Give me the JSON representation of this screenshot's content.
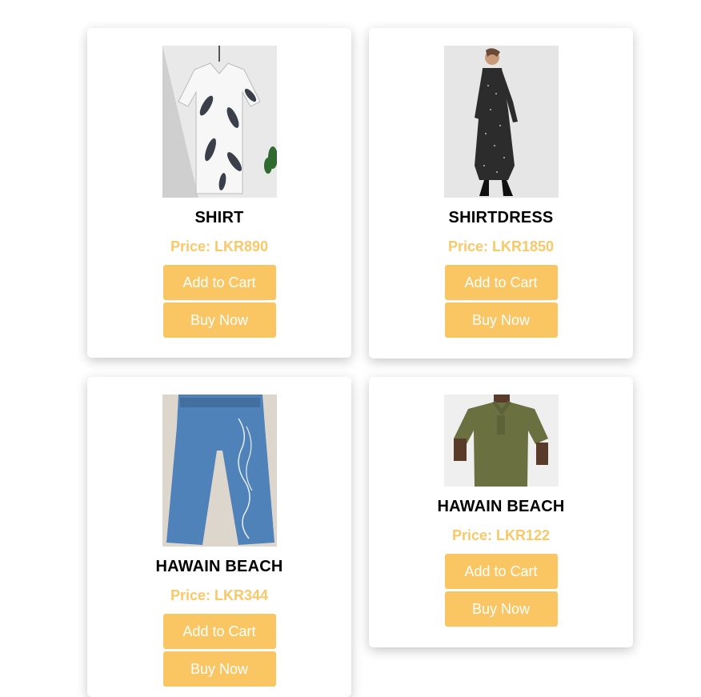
{
  "products": [
    {
      "name": "SHIRT",
      "price": "Price: LKR890",
      "image": "leaf-print-shirt",
      "add_to_cart": "Add to Cart",
      "buy_now": "Buy Now"
    },
    {
      "name": "SHIRTDRESS",
      "price": "Price: LKR1850",
      "image": "polka-dot-shirtdress",
      "add_to_cart": "Add to Cart",
      "buy_now": "Buy Now"
    },
    {
      "name": "HAWAIN BEACH",
      "price": "Price: LKR344",
      "image": "blue-jeans",
      "add_to_cart": "Add to Cart",
      "buy_now": "Buy Now"
    },
    {
      "name": "HAWAIN BEACH",
      "price": "Price: LKR122",
      "image": "olive-polo-shirt",
      "add_to_cart": "Add to Cart",
      "buy_now": "Buy Now"
    }
  ],
  "colors": {
    "accent": "#fac663",
    "price": "#f9c869",
    "button_text": "#ffffff"
  }
}
